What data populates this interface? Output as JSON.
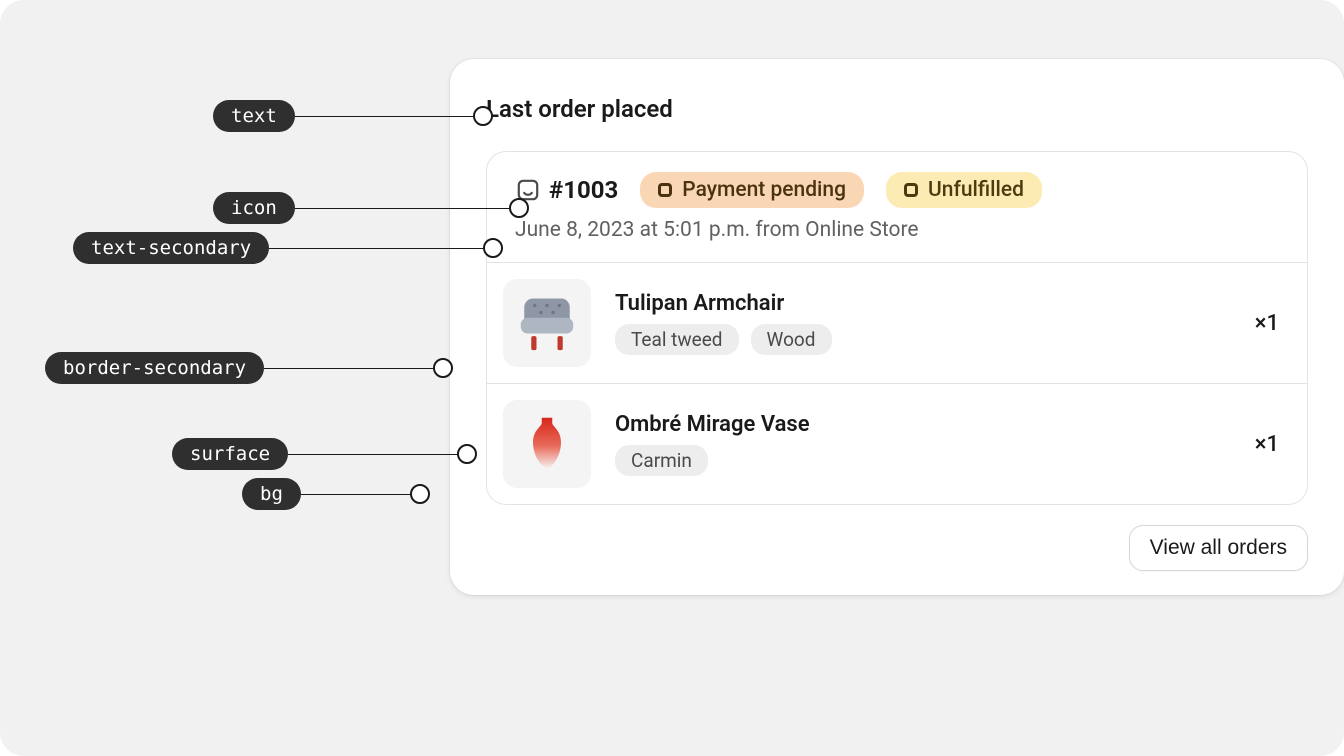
{
  "card": {
    "title": "Last order placed",
    "order": {
      "id": "#1003",
      "meta": "June 8, 2023 at 5:01 p.m. from Online Store",
      "badges": {
        "payment": "Payment pending",
        "fulfillment": "Unfulfilled"
      }
    },
    "items": [
      {
        "name": "Tulipan Armchair",
        "options": [
          "Teal tweed",
          "Wood"
        ],
        "qty": "×1"
      },
      {
        "name": "Ombré Mirage Vase",
        "options": [
          "Carmin"
        ],
        "qty": "×1"
      }
    ],
    "footer": {
      "view_all": "View all orders"
    }
  },
  "labels": {
    "text": "text",
    "icon": "icon",
    "text_secondary": "text-secondary",
    "border_secondary": "border-secondary",
    "surface": "surface",
    "bg": "bg"
  }
}
